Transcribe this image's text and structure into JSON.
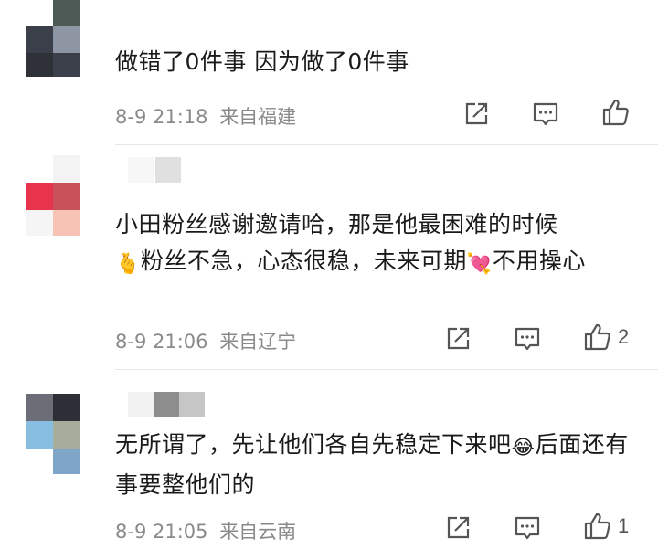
{
  "comments": [
    {
      "text": "做错了0件事 因为做了0件事",
      "time": "8-9 21:18",
      "location": "来自福建",
      "like_count": ""
    },
    {
      "text_part1": "小田粉丝感谢邀请哈，那是他最困难的时候",
      "emoji1": "🫰",
      "text_part2": "粉丝不急，心态很稳，未来可期",
      "emoji2": "💘",
      "text_part3": "不用操心",
      "time": "8-9 21:06",
      "location": "来自辽宁",
      "like_count": "2"
    },
    {
      "text_part1": "无所谓了，先让他们各自先稳定下来吧",
      "emoji1": "😂",
      "text_part2": "后面还有事要整他们的",
      "time": "8-9 21:05",
      "location": "来自云南",
      "like_count": "1"
    }
  ],
  "icons": {
    "share": "share-icon",
    "comment": "comment-icon",
    "like": "thumbs-up-icon"
  },
  "colors": {
    "meta_text": "#8a8a8a",
    "icon": "#555555",
    "divider": "#e6e6e6"
  }
}
